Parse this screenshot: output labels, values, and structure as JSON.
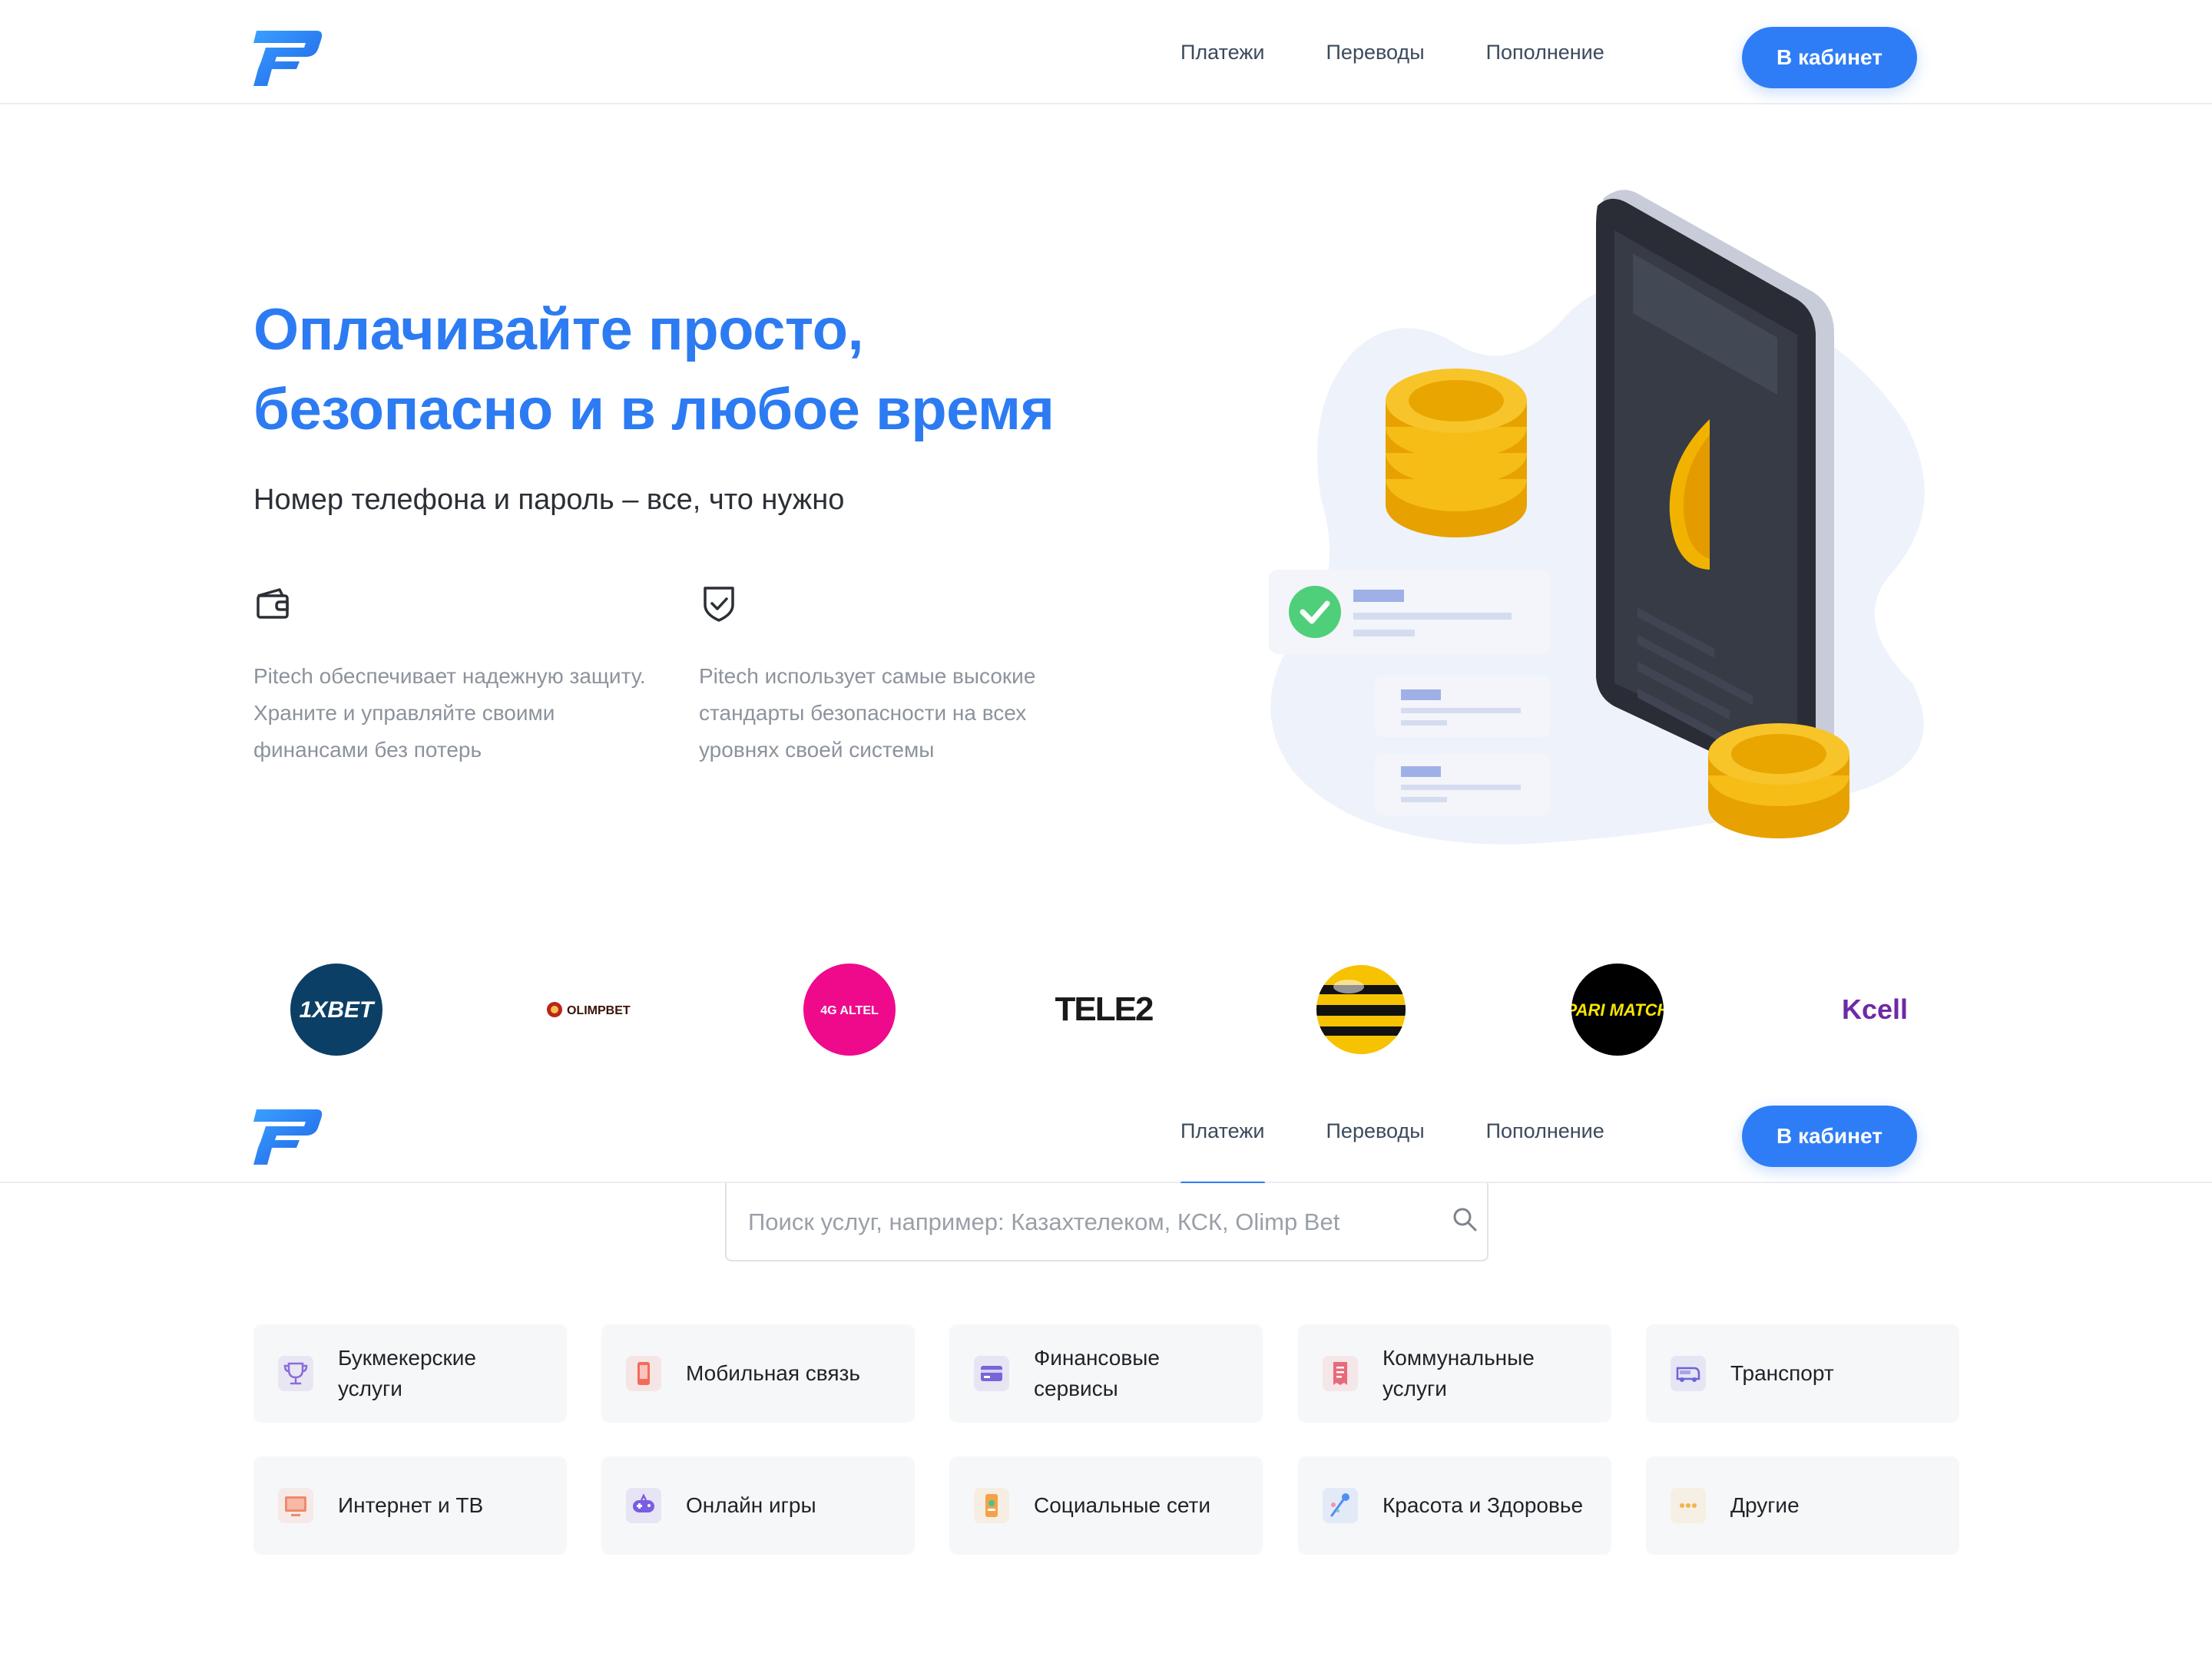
{
  "header": {
    "nav": [
      "Платежи",
      "Переводы",
      "Пополнение"
    ],
    "cabinet_button": "В кабинет"
  },
  "hero": {
    "title": "Оплачивайте просто, безопасно и в любое время",
    "subtitle": "Номер телефона и пароль – все, что нужно",
    "features": [
      {
        "icon": "wallet-icon",
        "text": "Pitech обеспечивает надежную защиту. Храните и управляйте своими финансами без потерь"
      },
      {
        "icon": "shield-check-icon",
        "text": "Pitech использует самые высокие стандарты безопасности на всех уровнях своей системы"
      }
    ]
  },
  "partners": [
    {
      "name": "1XBET",
      "color": "#0b3f66"
    },
    {
      "name": "OLIMPBET",
      "color": "#b8261a"
    },
    {
      "name": "4G ALTEL",
      "color": "#ef0a8c"
    },
    {
      "name": "TELE2",
      "color": "#1a1a1a"
    },
    {
      "name": "Beeline",
      "color": "#f7c200"
    },
    {
      "name": "PARI MATCH",
      "color": "#000000"
    },
    {
      "name": "Kcell",
      "color": "#6d2aa6"
    }
  ],
  "sticky_header": {
    "nav": [
      "Платежи",
      "Переводы",
      "Пополнение"
    ],
    "active_tab": "Платежи",
    "cabinet_button": "В кабинет"
  },
  "search": {
    "placeholder": "Поиск услуг, например: Казахтелеком, КСК, Olimp Bet"
  },
  "categories": [
    {
      "label": "Букмекерские услуги",
      "icon": "trophy-icon",
      "color": "#8b6bd9"
    },
    {
      "label": "Мобильная связь",
      "icon": "phone-icon",
      "color": "#f26b5b"
    },
    {
      "label": "Финансовые сервисы",
      "icon": "card-icon",
      "color": "#7a64d8"
    },
    {
      "label": "Коммунальные услуги",
      "icon": "receipt-icon",
      "color": "#e86a7a"
    },
    {
      "label": "Транспорт",
      "icon": "bus-icon",
      "color": "#6d63d8"
    },
    {
      "label": "Интернет и ТВ",
      "icon": "tv-icon",
      "color": "#f08a6a"
    },
    {
      "label": "Онлайн игры",
      "icon": "gamepad-icon",
      "color": "#7a5de0"
    },
    {
      "label": "Социальные сети",
      "icon": "social-icon",
      "color": "#f3a24a"
    },
    {
      "label": "Красота и Здоровье",
      "icon": "beauty-icon",
      "color": "#4f8df3"
    },
    {
      "label": "Другие",
      "icon": "dots-icon",
      "color": "#f4b24c"
    }
  ]
}
